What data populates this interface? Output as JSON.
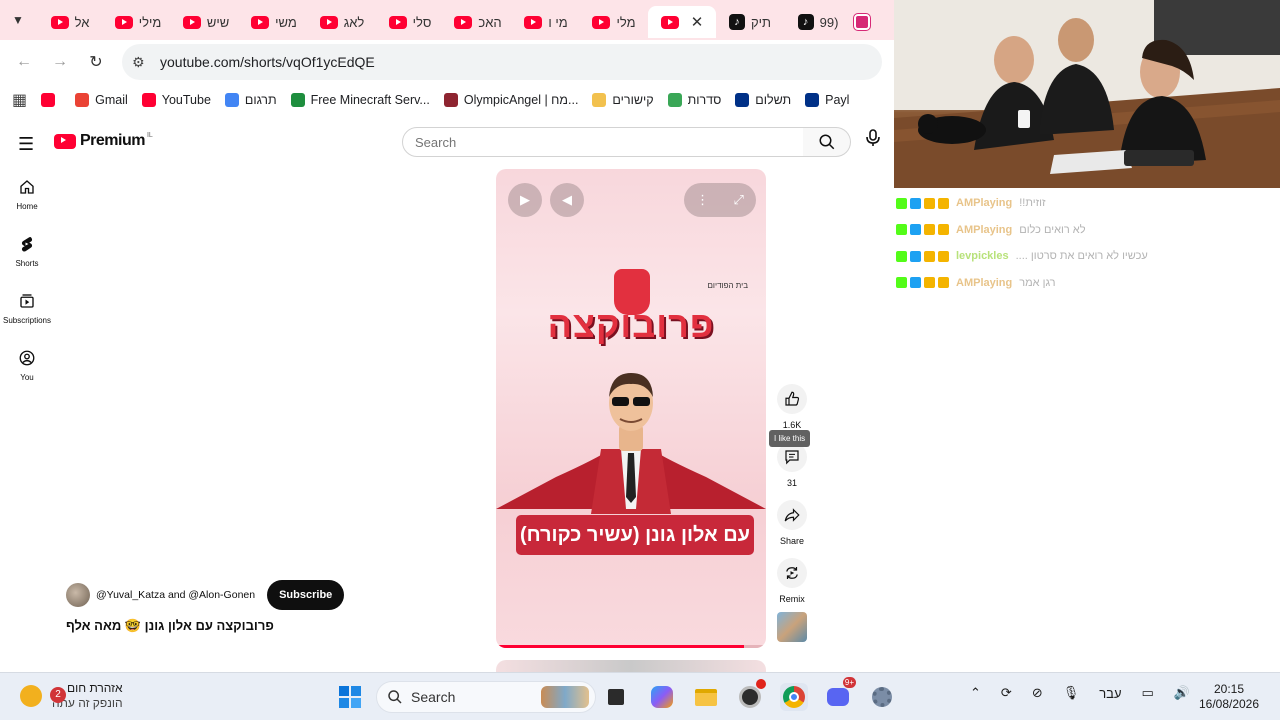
{
  "browser": {
    "tabs": [
      {
        "label": "אל",
        "icon": "youtube-icon",
        "active": false
      },
      {
        "label": "מילי",
        "icon": "youtube-icon",
        "active": false
      },
      {
        "label": "שיש",
        "icon": "youtube-icon",
        "active": false
      },
      {
        "label": "משי",
        "icon": "youtube-icon",
        "active": false
      },
      {
        "label": "לאג",
        "icon": "youtube-icon",
        "active": false
      },
      {
        "label": "סלי",
        "icon": "youtube-icon",
        "active": false
      },
      {
        "label": "האכ",
        "icon": "youtube-icon",
        "active": false
      },
      {
        "label": "מי ו",
        "icon": "youtube-icon",
        "active": false
      },
      {
        "label": "מלי",
        "icon": "youtube-icon",
        "active": false
      },
      {
        "label": "",
        "icon": "youtube-icon",
        "active": true
      },
      {
        "label": "תיק",
        "icon": "tiktok-icon",
        "active": false
      },
      {
        "label": "(99",
        "icon": "tiktok-icon",
        "active": false
      },
      {
        "label": "",
        "icon": "instagram-icon",
        "active": false
      }
    ],
    "close_glyph": "✕",
    "url": "youtube.com/shorts/vqOf1ycEdQE",
    "bookmarks": [
      {
        "label": "",
        "color": "#ff0033"
      },
      {
        "label": "Gmail",
        "color": "#ea4335"
      },
      {
        "label": "YouTube",
        "color": "#ff0033"
      },
      {
        "label": "תרגום",
        "color": "#4285f4"
      },
      {
        "label": "Free Minecraft Serv...",
        "color": "#1e8e3e"
      },
      {
        "label": "OlympicAngel | מח...",
        "color": "#8e2430"
      },
      {
        "label": "קישורים",
        "color": "#f2c14e"
      },
      {
        "label": "סדרות",
        "color": "#3aa757"
      },
      {
        "label": "תשלום",
        "color": "#003087"
      },
      {
        "label": "Payl",
        "color": "#003087"
      }
    ]
  },
  "youtube": {
    "logo_text": "Premium",
    "country_code": "IL",
    "search_placeholder": "Search",
    "sidebar": [
      {
        "label": "Home",
        "icon": "home-icon"
      },
      {
        "label": "Shorts",
        "icon": "shorts-icon"
      },
      {
        "label": "Subscriptions",
        "icon": "subscriptions-icon"
      },
      {
        "label": "You",
        "icon": "you-icon"
      }
    ],
    "video": {
      "brand": "בית הפודיום",
      "title_art": "פרובוקצה",
      "caption_art": "עם אלון גונן (עשיר כקורח)",
      "progress": 0.92
    },
    "actions": {
      "like_count": "1.6K",
      "like_tooltip": "I like this",
      "comment_count": "31",
      "share_label": "Share",
      "remix_label": "Remix"
    },
    "channel_text": "@Yuval_Katza and @Alon-Gonen",
    "subscribe_label": "Subscribe",
    "video_title": "פרובוקצה עם אלון גונן 🤓 מאה אלף"
  },
  "chat": {
    "messages": [
      {
        "user": "AMPlaying",
        "text": "זוזית!!",
        "user_color": "#e8c48a"
      },
      {
        "user": "AMPlaying",
        "text": "לא רואים כלום",
        "user_color": "#e8c48a"
      },
      {
        "user": "levpickles",
        "text": "עכשיו לא רואים את סרטון ....",
        "user_color": "#b8e27a"
      },
      {
        "user": "AMPlaying",
        "text": "רגן אמר",
        "user_color": "#e8c48a"
      }
    ]
  },
  "taskbar": {
    "weather_badge": "2",
    "weather_title": "אזהרת חום",
    "weather_sub": "הונפק זה עתה",
    "search_label": "Search",
    "language": "עבר",
    "time": "20:15",
    "date": "16/08/2026"
  }
}
